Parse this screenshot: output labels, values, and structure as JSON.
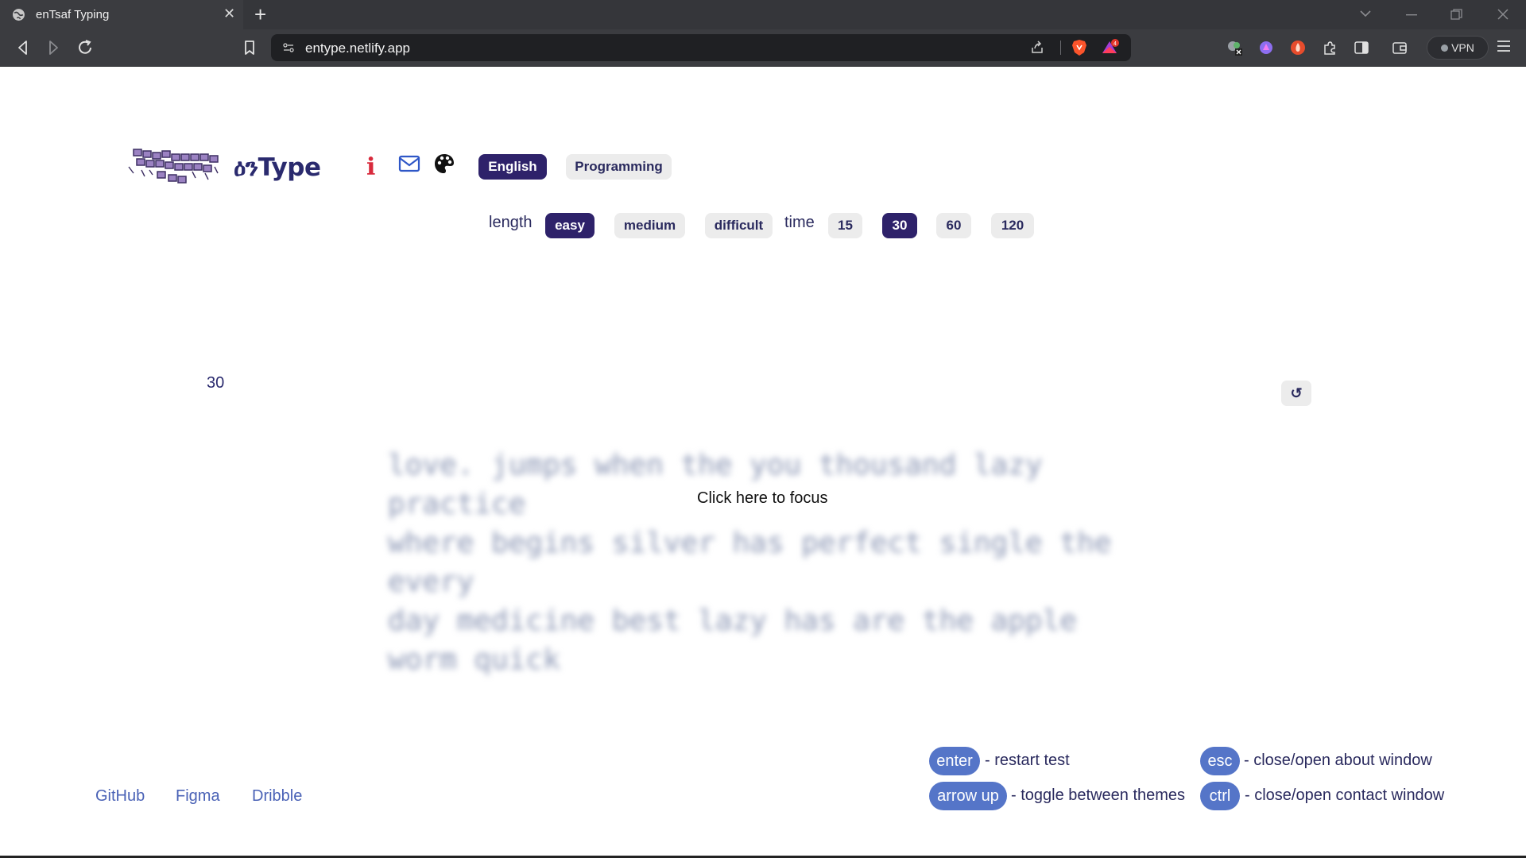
{
  "browser": {
    "tab_title": "enTsaf Typing",
    "tab_close": "✕",
    "new_tab": "+",
    "url": "entype.netlify.app",
    "vpn_label": "VPN",
    "rewards_count": "4"
  },
  "header": {
    "brand": "ዕንType",
    "info_glyph": "i",
    "languages": [
      {
        "label": "English",
        "active": true
      },
      {
        "label": "Programming",
        "active": false
      }
    ]
  },
  "options": {
    "length_label": "length",
    "length": [
      {
        "label": "easy",
        "active": true
      },
      {
        "label": "medium",
        "active": false
      },
      {
        "label": "difficult",
        "active": false
      }
    ],
    "time_label": "time",
    "time": [
      {
        "label": "15",
        "active": false
      },
      {
        "label": "30",
        "active": true
      },
      {
        "label": "60",
        "active": false
      },
      {
        "label": "120",
        "active": false
      }
    ]
  },
  "test": {
    "timer": "30",
    "restart_glyph": "↺",
    "lines": [
      "love. jumps when the you thousand lazy practice",
      "where begins silver has perfect single the every",
      "day medicine best lazy has are the apple worm quick"
    ],
    "focus_text": "Click here to focus"
  },
  "footer": {
    "links": [
      "GitHub",
      "Figma",
      "Dribble"
    ],
    "shortcuts": [
      {
        "key": "enter",
        "desc": "- restart test"
      },
      {
        "key": "arrow up",
        "desc": "- toggle between themes"
      },
      {
        "key": "esc",
        "desc": "- close/open about window"
      },
      {
        "key": "ctrl",
        "desc": "- close/open contact window"
      }
    ]
  },
  "colors": {
    "accent": "#2e226a",
    "key_blue": "#5575c8",
    "link": "#4a62b6",
    "info_red": "#d82a3c"
  }
}
